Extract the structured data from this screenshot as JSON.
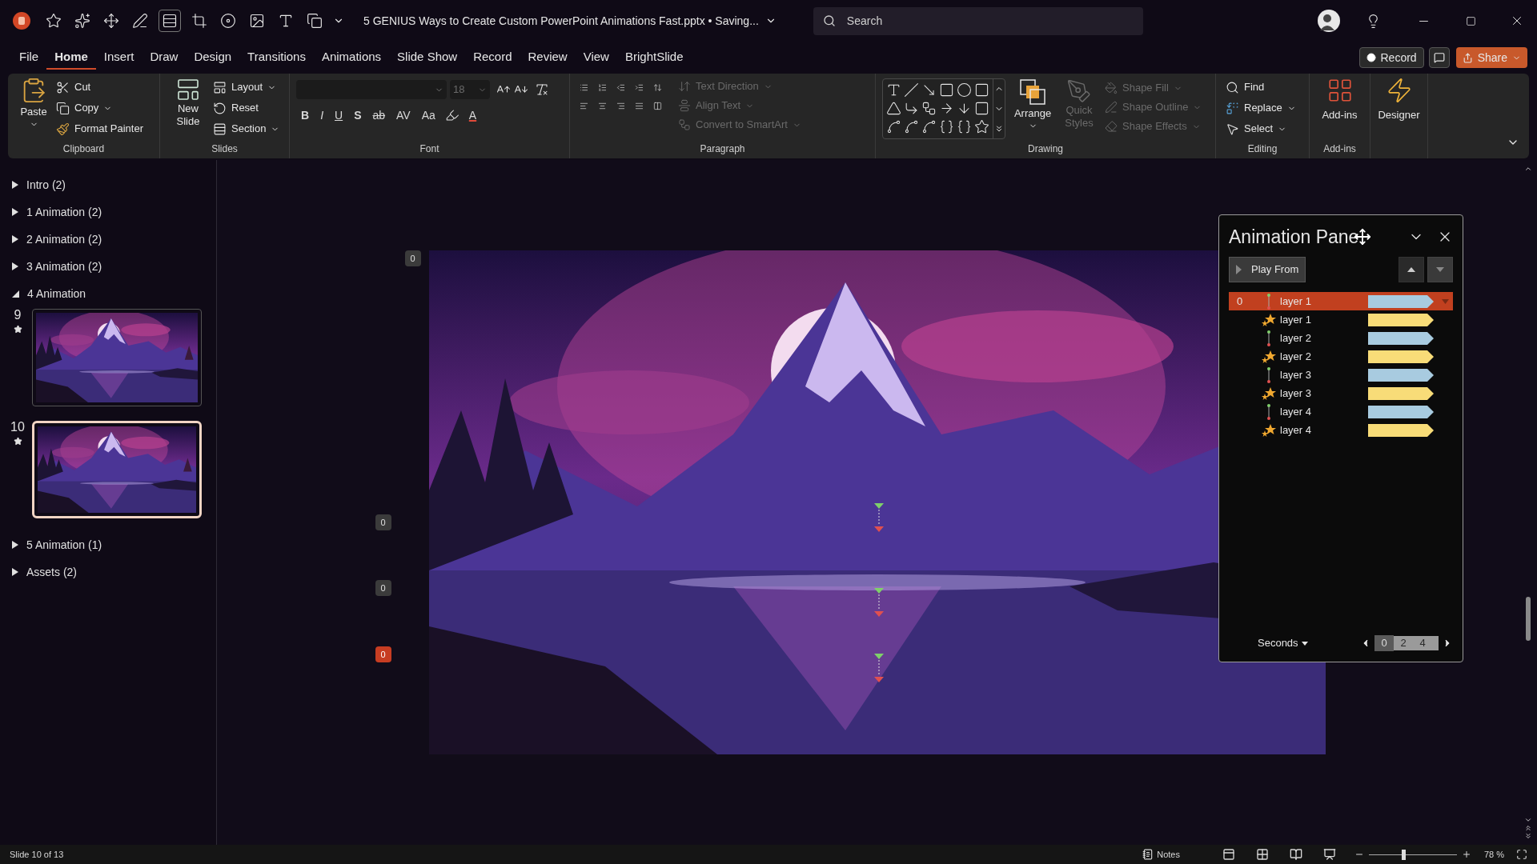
{
  "title_bar": {
    "title": "5 GENIUS Ways to Create Custom PowerPoint Animations Fast.pptx • Saving...",
    "search": {
      "placeholder": "Search"
    }
  },
  "menu_tabs": [
    {
      "label": "File",
      "selected": false
    },
    {
      "label": "Home",
      "selected": true
    },
    {
      "label": "Insert",
      "selected": false
    },
    {
      "label": "Draw",
      "selected": false
    },
    {
      "label": "Design",
      "selected": false
    },
    {
      "label": "Transitions",
      "selected": false
    },
    {
      "label": "Animations",
      "selected": false
    },
    {
      "label": "Slide Show",
      "selected": false
    },
    {
      "label": "Record",
      "selected": false
    },
    {
      "label": "Review",
      "selected": false
    },
    {
      "label": "View",
      "selected": false
    },
    {
      "label": "BrightSlide",
      "selected": false
    }
  ],
  "header_buttons": {
    "record": "Record",
    "share": "Share"
  },
  "ribbon": {
    "clipboard": {
      "label": "Clipboard",
      "paste": "Paste",
      "cut": "Cut",
      "copy": "Copy",
      "format_painter": "Format Painter"
    },
    "slides": {
      "label": "Slides",
      "new_slide": "New Slide",
      "layout": "Layout",
      "reset": "Reset",
      "section": "Section"
    },
    "font": {
      "label": "Font",
      "font_size": {
        "value": "18",
        "disabled": true
      },
      "format_buttons": [
        {
          "text": "B",
          "kind": "bold"
        },
        {
          "text": "I",
          "kind": "italic"
        },
        {
          "text": "U",
          "kind": "underline"
        },
        {
          "text": "S",
          "kind": "shadow"
        },
        {
          "text": "ab",
          "kind": "strike"
        },
        {
          "text": "AV",
          "kind": "spacing"
        },
        {
          "text": "Aa",
          "kind": "case"
        },
        {
          "text": "A",
          "kind": "color"
        }
      ]
    },
    "paragraph": {
      "label": "Paragraph",
      "commands": [
        {
          "label": "Text Direction",
          "disabled": true
        },
        {
          "label": "Align Text",
          "disabled": true
        },
        {
          "label": "Convert to SmartArt",
          "disabled": true
        }
      ]
    },
    "drawing": {
      "label": "Drawing",
      "arrange": {
        "label": "Arrange",
        "disabled": false
      },
      "quick_styles": {
        "label": "Quick Styles",
        "disabled": true
      },
      "commands": [
        {
          "label": "Shape Fill",
          "disabled": true
        },
        {
          "label": "Shape Outline",
          "disabled": true
        },
        {
          "label": "Shape Effects",
          "disabled": true
        }
      ]
    },
    "editing": {
      "label": "Editing",
      "find": "Find",
      "replace": "Replace",
      "select": "Select"
    },
    "addins": {
      "label": "Add-ins",
      "addins_button": "Add-ins",
      "designer": "Designer"
    }
  },
  "sections": [
    {
      "label": "Intro (2)",
      "expanded": false
    },
    {
      "label": "1 Animation (2)",
      "expanded": false
    },
    {
      "label": "2 Animation (2)",
      "expanded": false
    },
    {
      "label": "3 Animation (2)",
      "expanded": false
    },
    {
      "label": "4 Animation",
      "expanded": true,
      "slides": [
        {
          "number": "9",
          "selected": false
        },
        {
          "number": "10",
          "selected": true
        }
      ]
    },
    {
      "label": "5 Animation (1)",
      "expanded": false
    },
    {
      "label": "Assets (2)",
      "expanded": false
    }
  ],
  "slide": {
    "animation_tags": [
      {
        "label": "0",
        "selected": false
      },
      {
        "label": "0",
        "selected": false
      },
      {
        "label": "0",
        "selected": false
      },
      {
        "label": "0",
        "selected": true
      }
    ]
  },
  "animation_pane": {
    "title": "Animation Pane",
    "play_from": "Play From",
    "items": [
      {
        "order": "0",
        "name": "layer 1",
        "kind": "motion",
        "selected": true
      },
      {
        "name": "layer 1",
        "kind": "emphasis",
        "selected": false
      },
      {
        "name": "layer 2",
        "kind": "motion",
        "selected": false
      },
      {
        "name": "layer 2",
        "kind": "emphasis",
        "selected": false
      },
      {
        "name": "layer 3",
        "kind": "motion",
        "selected": false
      },
      {
        "name": "layer 3",
        "kind": "emphasis",
        "selected": false
      },
      {
        "name": "layer 4",
        "kind": "motion",
        "selected": false
      },
      {
        "name": "layer 4",
        "kind": "emphasis",
        "selected": false
      }
    ],
    "timeline": {
      "unit": "Seconds",
      "ticks": [
        "0",
        "2",
        "4"
      ]
    }
  },
  "status_bar": {
    "slide_info": "Slide 10 of 13",
    "notes": "Notes",
    "zoom": {
      "level": 0.39,
      "reading": "78 %"
    }
  }
}
